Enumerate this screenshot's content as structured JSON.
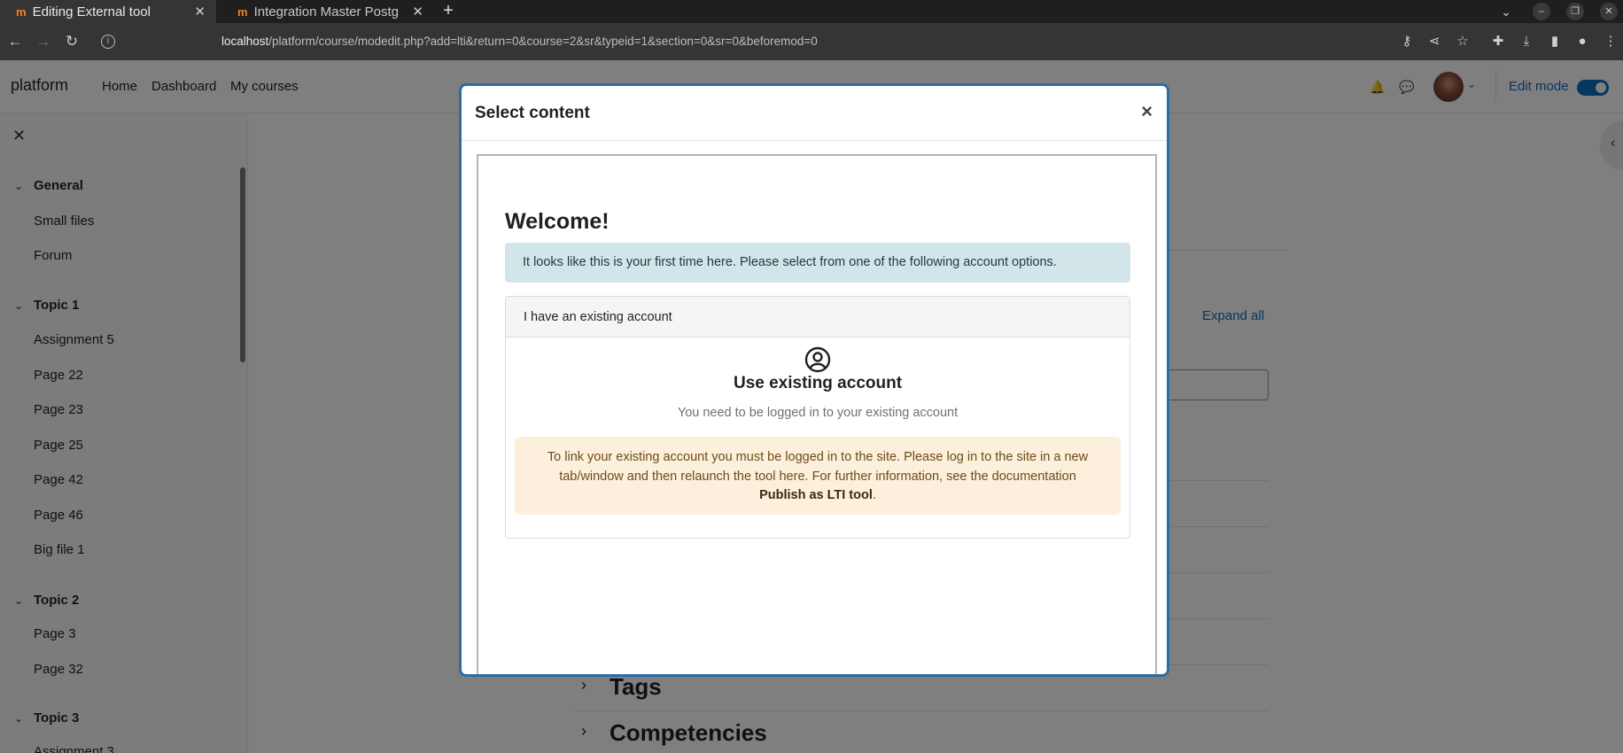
{
  "browser": {
    "tabs": [
      {
        "title": "Editing External tool",
        "favicon": "m"
      },
      {
        "title": "Integration Master Postg",
        "favicon": "m"
      }
    ],
    "url_host": "localhost",
    "url_path": "/platform/course/modedit.php?add=lti&return=0&course=2&sr&typeid=1&section=0&sr=0&beforemod=0"
  },
  "navbar": {
    "brand": "platform",
    "links": [
      "Home",
      "Dashboard",
      "My courses"
    ],
    "edit_mode": "Edit mode",
    "edit_mode_on": true
  },
  "sidebar": {
    "sections": [
      {
        "title": "General",
        "items": [
          "Small files",
          "Forum"
        ]
      },
      {
        "title": "Topic 1",
        "items": [
          "Assignment 5",
          "Page 22",
          "Page 23",
          "Page 25",
          "Page 42",
          "Page 46",
          "Big file 1"
        ]
      },
      {
        "title": "Topic 2",
        "items": [
          "Page 3",
          "Page 32"
        ]
      },
      {
        "title": "Topic 3",
        "items": [
          "Assignment 3"
        ]
      }
    ]
  },
  "page": {
    "expand_all": "Expand all",
    "sections": [
      "Tags",
      "Competencies"
    ]
  },
  "modal": {
    "title": "Select content",
    "close": "×",
    "welcome": "Welcome!",
    "info": "It looks like this is your first time here. Please select from one of the following account options.",
    "card_header": "I have an existing account",
    "card_title": "Use existing account",
    "card_sub": "You need to be logged in to your existing account",
    "warning_text": "To link your existing account you must be logged in to the site. Please log in to the site in a new tab/window and then relaunch the tool here. For further information, see the documentation",
    "warning_link": "Publish as LTI tool",
    "warning_end": "."
  },
  "colors": {
    "accent": "#0f6cbf",
    "modal_border": "#2e6ca5",
    "info_bg": "#d2e6ea",
    "warning_bg": "#fcefdc"
  }
}
